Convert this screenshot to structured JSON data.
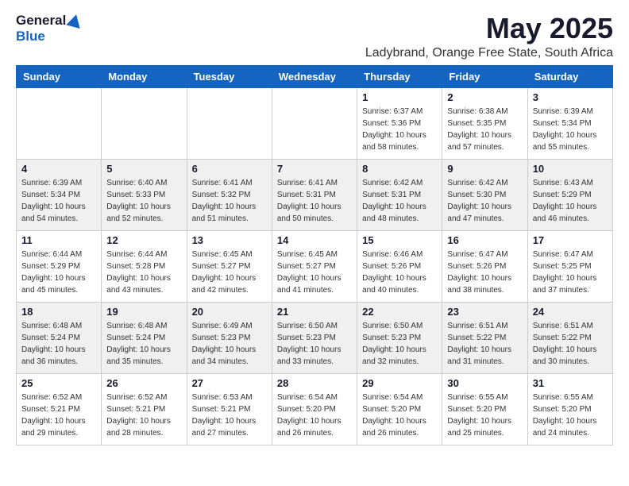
{
  "logo": {
    "general": "General",
    "blue": "Blue"
  },
  "title": {
    "month_year": "May 2025",
    "location": "Ladybrand, Orange Free State, South Africa"
  },
  "days_of_week": [
    "Sunday",
    "Monday",
    "Tuesday",
    "Wednesday",
    "Thursday",
    "Friday",
    "Saturday"
  ],
  "weeks": [
    [
      {
        "day": "",
        "info": ""
      },
      {
        "day": "",
        "info": ""
      },
      {
        "day": "",
        "info": ""
      },
      {
        "day": "",
        "info": ""
      },
      {
        "day": "1",
        "info": "Sunrise: 6:37 AM\nSunset: 5:36 PM\nDaylight: 10 hours and 58 minutes."
      },
      {
        "day": "2",
        "info": "Sunrise: 6:38 AM\nSunset: 5:35 PM\nDaylight: 10 hours and 57 minutes."
      },
      {
        "day": "3",
        "info": "Sunrise: 6:39 AM\nSunset: 5:34 PM\nDaylight: 10 hours and 55 minutes."
      }
    ],
    [
      {
        "day": "4",
        "info": "Sunrise: 6:39 AM\nSunset: 5:34 PM\nDaylight: 10 hours and 54 minutes."
      },
      {
        "day": "5",
        "info": "Sunrise: 6:40 AM\nSunset: 5:33 PM\nDaylight: 10 hours and 52 minutes."
      },
      {
        "day": "6",
        "info": "Sunrise: 6:41 AM\nSunset: 5:32 PM\nDaylight: 10 hours and 51 minutes."
      },
      {
        "day": "7",
        "info": "Sunrise: 6:41 AM\nSunset: 5:31 PM\nDaylight: 10 hours and 50 minutes."
      },
      {
        "day": "8",
        "info": "Sunrise: 6:42 AM\nSunset: 5:31 PM\nDaylight: 10 hours and 48 minutes."
      },
      {
        "day": "9",
        "info": "Sunrise: 6:42 AM\nSunset: 5:30 PM\nDaylight: 10 hours and 47 minutes."
      },
      {
        "day": "10",
        "info": "Sunrise: 6:43 AM\nSunset: 5:29 PM\nDaylight: 10 hours and 46 minutes."
      }
    ],
    [
      {
        "day": "11",
        "info": "Sunrise: 6:44 AM\nSunset: 5:29 PM\nDaylight: 10 hours and 45 minutes."
      },
      {
        "day": "12",
        "info": "Sunrise: 6:44 AM\nSunset: 5:28 PM\nDaylight: 10 hours and 43 minutes."
      },
      {
        "day": "13",
        "info": "Sunrise: 6:45 AM\nSunset: 5:27 PM\nDaylight: 10 hours and 42 minutes."
      },
      {
        "day": "14",
        "info": "Sunrise: 6:45 AM\nSunset: 5:27 PM\nDaylight: 10 hours and 41 minutes."
      },
      {
        "day": "15",
        "info": "Sunrise: 6:46 AM\nSunset: 5:26 PM\nDaylight: 10 hours and 40 minutes."
      },
      {
        "day": "16",
        "info": "Sunrise: 6:47 AM\nSunset: 5:26 PM\nDaylight: 10 hours and 38 minutes."
      },
      {
        "day": "17",
        "info": "Sunrise: 6:47 AM\nSunset: 5:25 PM\nDaylight: 10 hours and 37 minutes."
      }
    ],
    [
      {
        "day": "18",
        "info": "Sunrise: 6:48 AM\nSunset: 5:24 PM\nDaylight: 10 hours and 36 minutes."
      },
      {
        "day": "19",
        "info": "Sunrise: 6:48 AM\nSunset: 5:24 PM\nDaylight: 10 hours and 35 minutes."
      },
      {
        "day": "20",
        "info": "Sunrise: 6:49 AM\nSunset: 5:23 PM\nDaylight: 10 hours and 34 minutes."
      },
      {
        "day": "21",
        "info": "Sunrise: 6:50 AM\nSunset: 5:23 PM\nDaylight: 10 hours and 33 minutes."
      },
      {
        "day": "22",
        "info": "Sunrise: 6:50 AM\nSunset: 5:23 PM\nDaylight: 10 hours and 32 minutes."
      },
      {
        "day": "23",
        "info": "Sunrise: 6:51 AM\nSunset: 5:22 PM\nDaylight: 10 hours and 31 minutes."
      },
      {
        "day": "24",
        "info": "Sunrise: 6:51 AM\nSunset: 5:22 PM\nDaylight: 10 hours and 30 minutes."
      }
    ],
    [
      {
        "day": "25",
        "info": "Sunrise: 6:52 AM\nSunset: 5:21 PM\nDaylight: 10 hours and 29 minutes."
      },
      {
        "day": "26",
        "info": "Sunrise: 6:52 AM\nSunset: 5:21 PM\nDaylight: 10 hours and 28 minutes."
      },
      {
        "day": "27",
        "info": "Sunrise: 6:53 AM\nSunset: 5:21 PM\nDaylight: 10 hours and 27 minutes."
      },
      {
        "day": "28",
        "info": "Sunrise: 6:54 AM\nSunset: 5:20 PM\nDaylight: 10 hours and 26 minutes."
      },
      {
        "day": "29",
        "info": "Sunrise: 6:54 AM\nSunset: 5:20 PM\nDaylight: 10 hours and 26 minutes."
      },
      {
        "day": "30",
        "info": "Sunrise: 6:55 AM\nSunset: 5:20 PM\nDaylight: 10 hours and 25 minutes."
      },
      {
        "day": "31",
        "info": "Sunrise: 6:55 AM\nSunset: 5:20 PM\nDaylight: 10 hours and 24 minutes."
      }
    ]
  ]
}
